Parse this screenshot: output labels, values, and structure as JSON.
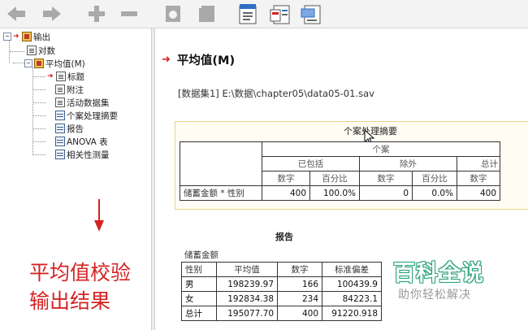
{
  "tree": {
    "root": "输出",
    "children": [
      "对数",
      "平均值(M)"
    ],
    "sub_items": [
      "标题",
      "附注",
      "活动数据集",
      "个案处理摘要",
      "报告",
      "ANOVA 表",
      "相关性测量"
    ]
  },
  "overlay_note": [
    "平均值校验",
    "输出结果"
  ],
  "content": {
    "heading": "平均值(M)",
    "dataset_line": "[数据集1] E:\\数据\\chapter05\\data05-01.sav",
    "case_summary": {
      "title": "个案处理摘要",
      "group_header": "个案",
      "sub_groups": [
        "已包括",
        "除外",
        "总计"
      ],
      "col_headers": [
        "数字",
        "百分比",
        "数字",
        "百分比",
        "数字"
      ],
      "row_label": "储蓄金额 * 性别",
      "values": [
        "400",
        "100.0%",
        "0",
        "0.0%",
        "400"
      ]
    },
    "report": {
      "title": "报告",
      "variable": "储蓄金额",
      "headers": [
        "性别",
        "平均值",
        "数字",
        "标准偏差"
      ],
      "rows": [
        [
          "男",
          "198239.97",
          "166",
          "100439.9"
        ],
        [
          "女",
          "192834.38",
          "234",
          "84223.1"
        ],
        [
          "总计",
          "195077.70",
          "400",
          "91220.918"
        ]
      ]
    }
  },
  "watermark": {
    "main": "百科全说",
    "sub": "助你轻松解决"
  },
  "colors": {
    "accent_red": "#d42424",
    "toolbar_gray": "#a9a9a9",
    "watermark_green": "#2aa37a"
  }
}
